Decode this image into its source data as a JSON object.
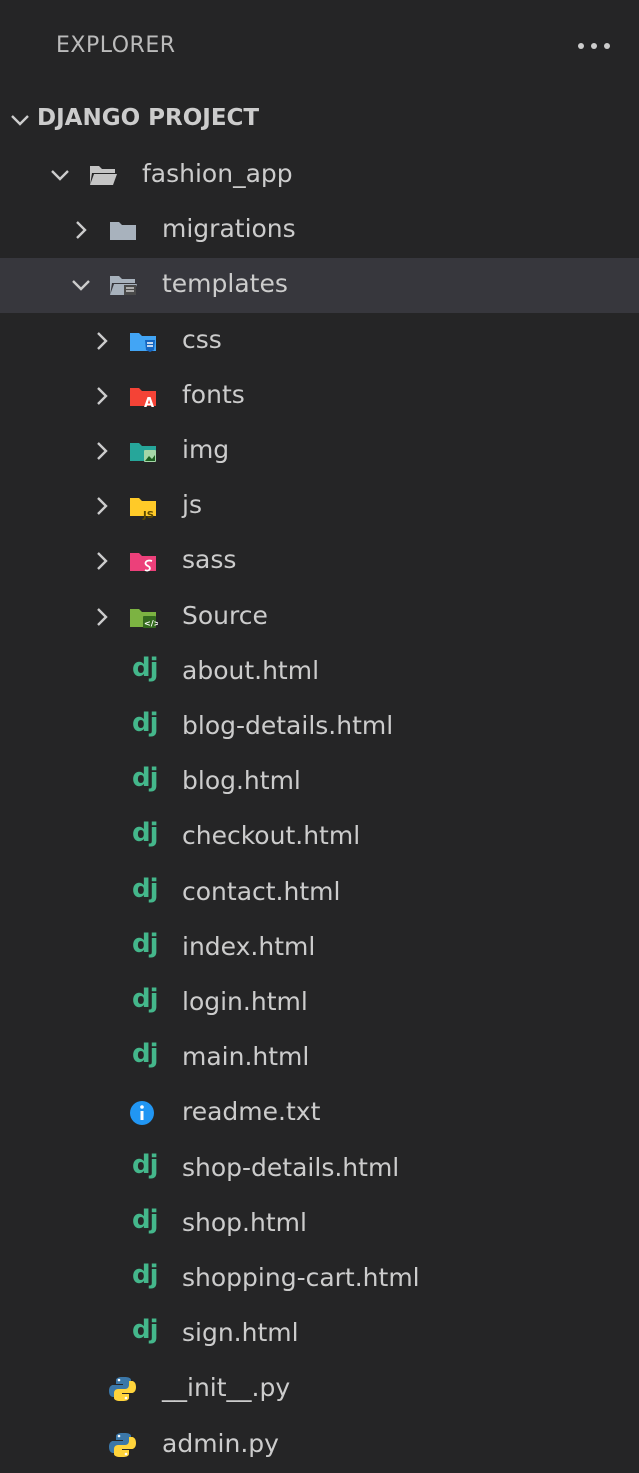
{
  "header": {
    "title": "EXPLORER",
    "more_icon": "ellipsis-icon"
  },
  "section": {
    "title": "DJANGO PROJECT"
  },
  "tree": [
    {
      "label": "fashion_app",
      "kind": "folder-open",
      "depth": 1,
      "expanded": true
    },
    {
      "label": "migrations",
      "kind": "folder",
      "depth": 2,
      "expanded": false
    },
    {
      "label": "templates",
      "kind": "folder-templates",
      "depth": 2,
      "expanded": true,
      "selected": true
    },
    {
      "label": "css",
      "kind": "folder-css",
      "depth": 3,
      "expanded": false
    },
    {
      "label": "fonts",
      "kind": "folder-fonts",
      "depth": 3,
      "expanded": false
    },
    {
      "label": "img",
      "kind": "folder-img",
      "depth": 3,
      "expanded": false
    },
    {
      "label": "js",
      "kind": "folder-js",
      "depth": 3,
      "expanded": false
    },
    {
      "label": "sass",
      "kind": "folder-sass",
      "depth": 3,
      "expanded": false
    },
    {
      "label": "Source",
      "kind": "folder-source",
      "depth": 3,
      "expanded": false
    },
    {
      "label": "about.html",
      "kind": "django",
      "depth": 3
    },
    {
      "label": "blog-details.html",
      "kind": "django",
      "depth": 3
    },
    {
      "label": "blog.html",
      "kind": "django",
      "depth": 3
    },
    {
      "label": "checkout.html",
      "kind": "django",
      "depth": 3
    },
    {
      "label": "contact.html",
      "kind": "django",
      "depth": 3
    },
    {
      "label": "index.html",
      "kind": "django",
      "depth": 3
    },
    {
      "label": "login.html",
      "kind": "django",
      "depth": 3
    },
    {
      "label": "main.html",
      "kind": "django",
      "depth": 3
    },
    {
      "label": "readme.txt",
      "kind": "info",
      "depth": 3
    },
    {
      "label": "shop-details.html",
      "kind": "django",
      "depth": 3
    },
    {
      "label": "shop.html",
      "kind": "django",
      "depth": 3
    },
    {
      "label": "shopping-cart.html",
      "kind": "django",
      "depth": 3
    },
    {
      "label": "sign.html",
      "kind": "django",
      "depth": 3
    },
    {
      "label": "__init__.py",
      "kind": "python",
      "depth": 2
    },
    {
      "label": "admin.py",
      "kind": "python",
      "depth": 2
    }
  ],
  "colors": {
    "background": "#252526",
    "selected_row": "#37373d",
    "text": "#cccccc",
    "django_green": "#44b78b",
    "css_blue": "#42a5f5",
    "fonts_red": "#f44336",
    "img_teal": "#26a69a",
    "js_yellow": "#ffca28",
    "sass_pink": "#ec407a",
    "source_green": "#7cb342",
    "info_blue": "#2196f3",
    "python_blue": "#3b77a8",
    "python_yellow": "#ffd43b"
  }
}
